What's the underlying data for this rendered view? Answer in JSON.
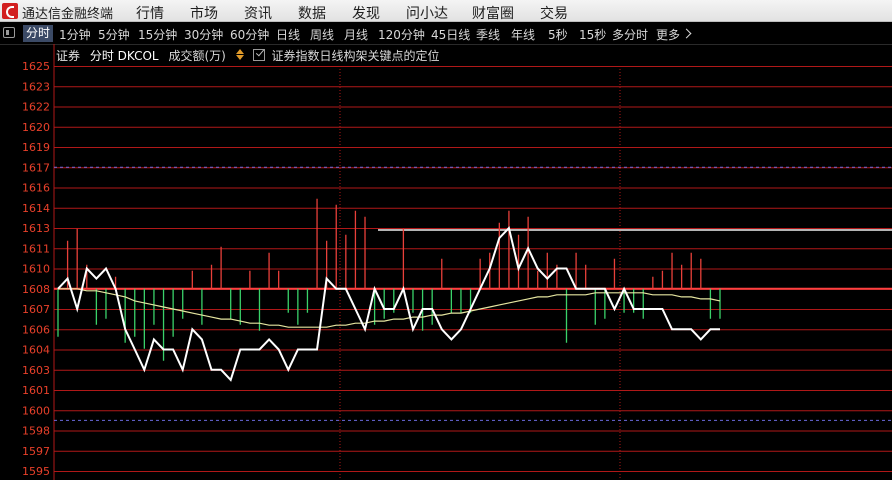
{
  "app": {
    "title": "通达信金融终端"
  },
  "menu": [
    "行情",
    "市场",
    "资讯",
    "数据",
    "发现",
    "问小达",
    "财富圈",
    "交易"
  ],
  "tabs": [
    {
      "label": "分时",
      "active": true
    },
    {
      "label": "1分钟"
    },
    {
      "label": "5分钟"
    },
    {
      "label": "15分钟"
    },
    {
      "label": "30分钟"
    },
    {
      "label": "60分钟"
    },
    {
      "label": "日线"
    },
    {
      "label": "周线"
    },
    {
      "label": "月线"
    },
    {
      "label": "120分钟"
    },
    {
      "label": "45日线"
    },
    {
      "label": "季线"
    },
    {
      "label": "年线"
    },
    {
      "label": "5秒"
    },
    {
      "label": "15秒"
    },
    {
      "label": "多分时"
    },
    {
      "label": "更多"
    }
  ],
  "info": {
    "stock": "证券",
    "indicator": "分时 DKCOL",
    "volume": "成交额(万)",
    "position_label": "证券指数日线构架关键点的定位"
  },
  "colors": {
    "up": "#e8403a",
    "down": "#3ad26a",
    "price": "#ffffff",
    "avg": "#e6e6a0",
    "grid": "#b01818",
    "axis_text": "#e8402a",
    "dash_grid": "#6a6adc",
    "base": "#ff4040"
  },
  "chart_data": {
    "type": "line",
    "y_ticks": [
      1625,
      1623,
      1622,
      1620,
      1619,
      1617,
      1616,
      1614,
      1613,
      1611,
      1610,
      1608,
      1607,
      1606,
      1604,
      1603,
      1601,
      1600,
      1598,
      1597,
      1595
    ],
    "price": [
      1608,
      1609,
      1607,
      1610,
      1609,
      1610,
      1608,
      1606,
      1604,
      1603,
      1605,
      1604,
      1604,
      1603,
      1606,
      1605,
      1603,
      1603,
      1602,
      1604,
      1604,
      1604,
      1605,
      1604,
      1603,
      1604,
      1604,
      1604,
      1609,
      1608,
      1608,
      1607,
      1606,
      1608,
      1607,
      1607,
      1608,
      1606,
      1607,
      1607,
      1606,
      1605,
      1606,
      1607,
      1608,
      1610,
      1612,
      1613,
      1610,
      1611,
      1610,
      1609,
      1610,
      1610,
      1608,
      1608,
      1608,
      1608,
      1607,
      1608,
      1607,
      1607,
      1607,
      1607,
      1606,
      1606,
      1606,
      1605,
      1606,
      1606
    ],
    "avg": [
      1608,
      1608,
      1608,
      1607.9,
      1607.9,
      1607.8,
      1607.7,
      1607.6,
      1607.4,
      1607.3,
      1607.2,
      1607.1,
      1607,
      1606.9,
      1606.8,
      1606.7,
      1606.6,
      1606.5,
      1606.5,
      1606.4,
      1606.3,
      1606.3,
      1606.2,
      1606.2,
      1606.1,
      1606.1,
      1606.1,
      1606.1,
      1606.1,
      1606.2,
      1606.2,
      1606.3,
      1606.3,
      1606.4,
      1606.4,
      1606.5,
      1606.5,
      1606.6,
      1606.6,
      1606.7,
      1606.7,
      1606.8,
      1606.8,
      1606.9,
      1607,
      1607.1,
      1607.2,
      1607.3,
      1607.4,
      1607.5,
      1607.6,
      1607.6,
      1607.7,
      1607.7,
      1607.7,
      1607.7,
      1607.8,
      1607.8,
      1607.8,
      1607.8,
      1607.8,
      1607.8,
      1607.7,
      1607.7,
      1607.7,
      1607.6,
      1607.6,
      1607.5,
      1607.5,
      1607.4
    ],
    "volume": [
      -8,
      8,
      10,
      4,
      -6,
      -5,
      2,
      -9,
      -8,
      -10,
      -6,
      -12,
      -8,
      -5,
      3,
      -6,
      4,
      7,
      -5,
      -6,
      3,
      -7,
      6,
      3,
      -4,
      -6,
      -4,
      15,
      8,
      14,
      9,
      13,
      12,
      -6,
      -5,
      -4,
      10,
      -4,
      -7,
      -6,
      5,
      -4,
      -4,
      -4,
      5,
      6,
      11,
      13,
      9,
      12,
      3,
      6,
      4,
      -9,
      6,
      4,
      -6,
      -5,
      5,
      -4,
      -4,
      -5,
      2,
      3,
      6,
      4,
      6,
      5,
      -5,
      -5
    ],
    "base_price": 1608,
    "dash_lines": [
      1617,
      1599
    ],
    "marker_segment": {
      "value": 1612.8
    }
  }
}
